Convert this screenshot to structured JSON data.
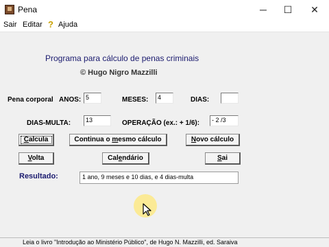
{
  "window": {
    "title": "Pena",
    "controls": {
      "minimize": "─",
      "maximize": "☐",
      "close": "✕"
    }
  },
  "menu": {
    "items": [
      "Sair",
      "Editar",
      "Ajuda"
    ],
    "help_icon_glyph": "?"
  },
  "header": {
    "title": "Programa para cálculo de penas criminais",
    "author": "© Hugo Nigro Mazzilli"
  },
  "form": {
    "pena_label": "Pena corporal",
    "anos_label": "ANOS:",
    "anos_value": "5",
    "meses_label": "MESES:",
    "meses_value": "4",
    "dias_label": "DIAS:",
    "dias_value": "",
    "dias_multa_label": "DIAS-MULTA:",
    "dias_multa_value": "13",
    "operacao_label": "OPERAÇÃO (ex.: + 1/6):",
    "operacao_value": "- 2 /3"
  },
  "buttons": {
    "calcula": {
      "underline": "C",
      "rest": "alcula"
    },
    "continua": {
      "pre": "Continua o ",
      "underline": "m",
      "rest": "esmo cálculo"
    },
    "novo": {
      "underline": "N",
      "rest": "ovo cálculo"
    },
    "volta": {
      "underline": "V",
      "rest": "olta"
    },
    "calendario": {
      "pre": "Cal",
      "underline": "e",
      "rest": "ndário"
    },
    "sai": {
      "underline": "S",
      "rest": "ai"
    }
  },
  "result": {
    "label": "Resultado:",
    "value": "1 ano,  9 meses e 10 dias, e   4 dias-multa"
  },
  "status": {
    "text": "Leia o livro \"Introdução ao Ministério Público\", de Hugo N. Mazzilli, ed. Saraiva"
  },
  "colors": {
    "heading": "#1a1a6e",
    "window_bg": "#f0f0f0",
    "cursor_highlight": "#ffe878"
  }
}
